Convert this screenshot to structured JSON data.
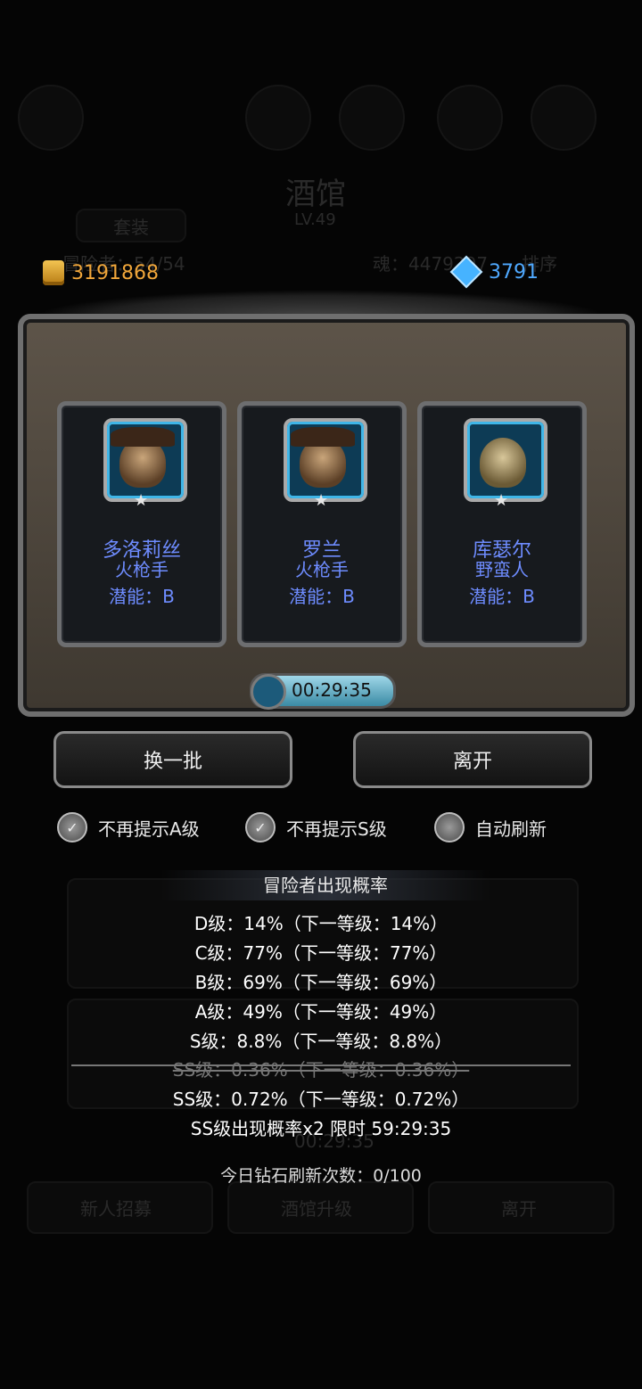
{
  "background": {
    "title": "酒馆",
    "level": "LV.49",
    "tab_set": "套装",
    "adventurers": "冒险者：54/54",
    "soul": "魂：4479297",
    "sort": "排序",
    "bottom_buttons": [
      "新人招募",
      "酒馆升级",
      "离开"
    ],
    "faded_timer": "00:29:35"
  },
  "currency": {
    "gold": "3191868",
    "gems": "3791"
  },
  "heroes": [
    {
      "name": "多洛莉丝",
      "class": "火枪手",
      "potential": "潜能：B"
    },
    {
      "name": "罗兰",
      "class": "火枪手",
      "potential": "潜能：B"
    },
    {
      "name": "库瑟尔",
      "class": "野蛮人",
      "potential": "潜能：B"
    }
  ],
  "timer": "00:29:35",
  "buttons": {
    "refresh_batch": "换一批",
    "leave": "离开"
  },
  "options": [
    {
      "label": "不再提示A级",
      "checked": true
    },
    {
      "label": "不再提示S级",
      "checked": true
    },
    {
      "label": "自动刷新",
      "checked": false
    }
  ],
  "probability": {
    "title": "冒险者出现概率",
    "lines": [
      "D级：14%（下一等级：14%）",
      "C级：77%（下一等级：77%）",
      "B级：69%（下一等级：69%）",
      "A级：49%（下一等级：49%）",
      "S级：8.8%（下一等级：8.8%）"
    ],
    "struck_line": "SS级：0.36%（下一等级：0.36%）",
    "ss_line": "SS级：0.72%（下一等级：0.72%）",
    "bonus_line": "SS级出现概率x2 限时 59:29:35"
  },
  "refresh_count": "今日钻石刷新次数：0/100",
  "colors": {
    "hero_text": "#6e8cff",
    "gold_text": "#f0a63a",
    "gem_text": "#4fa9ff"
  }
}
